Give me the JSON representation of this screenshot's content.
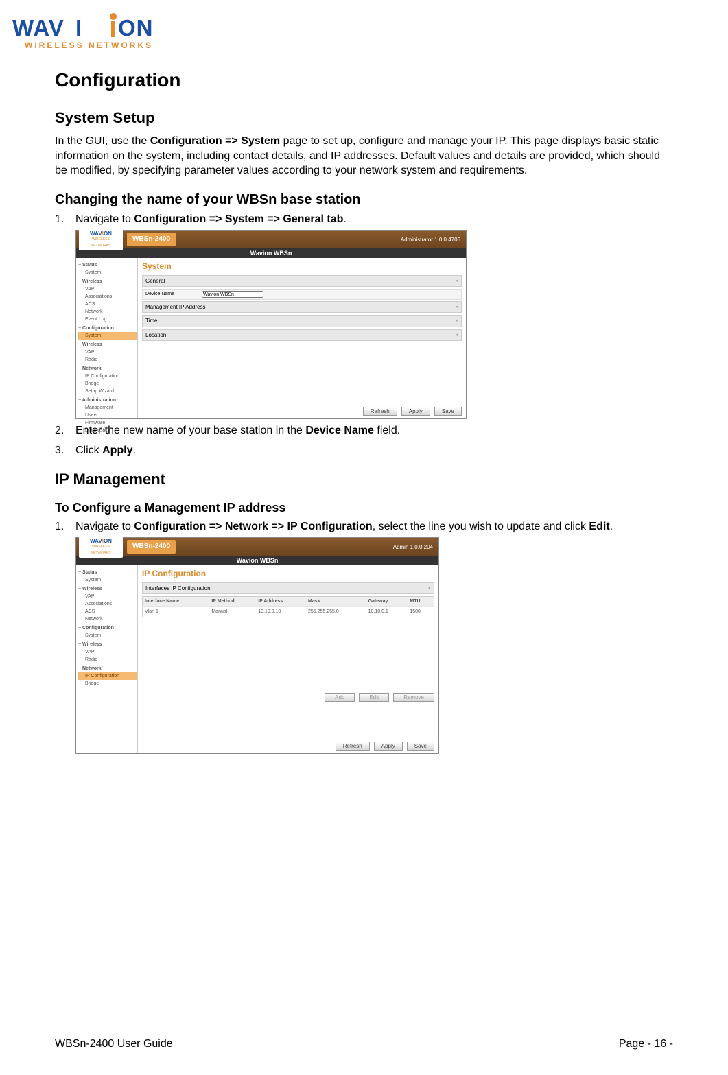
{
  "logo": {
    "brand_top": "WAV",
    "brand_dot_letter": "I",
    "brand_end": "ON",
    "tagline": "WIRELESS NETWORKS"
  },
  "headings": {
    "h1": "Configuration",
    "h2_system_setup": "System Setup",
    "h3_changing_name": "Changing the name of your WBSn base station",
    "h2_ip_mgmt": "IP Management",
    "h3_config_mgmt_ip": "To Configure a Management IP address"
  },
  "paragraphs": {
    "system_setup_intro_pre": "In the GUI, use the ",
    "system_setup_intro_bold": "Configuration => System",
    "system_setup_intro_post": " page to set up, configure and manage your IP. This page displays basic static information on the system, including contact details, and IP addresses. Default values and details are provided, which should be modified, by specifying parameter values according to your network system and requirements."
  },
  "steps_section1": {
    "s1_pre": "Navigate to ",
    "s1_bold": "Configuration => System => General tab",
    "s1_post": ".",
    "s2_pre": "Enter the new name of your base station in the ",
    "s2_bold": "Device Name",
    "s2_post": " field.",
    "s3_pre": "Click ",
    "s3_bold": "Apply",
    "s3_post": "."
  },
  "steps_section2": {
    "s1_pre": "Navigate to ",
    "s1_bold1": "Configuration => Network => IP Configuration",
    "s1_mid": ", select the line you wish to update and click ",
    "s1_bold2": "Edit",
    "s1_post": "."
  },
  "screenshot1": {
    "product": "WBSn-2400",
    "admin": "Administrator 1.0.0.4706",
    "subheader": "Wavion WBSn",
    "nav": {
      "g1": "Status",
      "i1a": "System",
      "g2": "Wireless",
      "i2a": "VAP",
      "i2b": "Associations",
      "i2c": "ACS",
      "i3": "Network",
      "i4": "Event Log",
      "g3": "Configuration",
      "sel": "System",
      "g4": "Wireless",
      "i5": "VAP",
      "i6": "Radio",
      "g5": "Network",
      "i7": "IP Configuration",
      "i8": "Bridge",
      "i9": "Setup Wizard",
      "g6": "Administration",
      "i10": "Management",
      "i11": "Users",
      "i12": "Firmware",
      "i13": "Diagnostics"
    },
    "page_title": "System",
    "sec_general": "General",
    "row_device_name_label": "Device Name",
    "row_device_name_value": "Wavion WBSn",
    "sec_mgmt_ip": "Management IP Address",
    "sec_time": "Time",
    "sec_location": "Location",
    "btn_refresh": "Refresh",
    "btn_apply": "Apply",
    "btn_save": "Save"
  },
  "screenshot2": {
    "product": "WBSn-2400",
    "admin": "Admin 1.0.0.204",
    "subheader": "Wavion WBSn",
    "nav": {
      "g1": "Status",
      "i1": "System",
      "g2": "Wireless",
      "i2": "VAP",
      "i3": "Associations",
      "i4": "ACS",
      "i5": "Network",
      "g3": "Configuration",
      "i6": "System",
      "g4": "Wireless",
      "i7": "VAP",
      "i8": "Radio",
      "g5": "Network",
      "sel": "IP Configuration",
      "i9": "Bridge"
    },
    "page_title": "IP Configuration",
    "sec_interfaces": "Interfaces IP Configuration",
    "th_iface": "Interface Name",
    "th_method": "IP Method",
    "th_addr": "IP Address",
    "th_mask": "Mask",
    "th_gw": "Gateway",
    "th_mtu": "MTU",
    "td_iface": "Vlan 1",
    "td_method": "Manual",
    "td_addr": "10.10.0.10",
    "td_mask": "255.255.255.0",
    "td_gw": "10.10.0.1",
    "td_mtu": "1500",
    "btn_add": "Add",
    "btn_edit": "Edit",
    "btn_remove": "Remove",
    "btn_refresh": "Refresh",
    "btn_apply": "Apply",
    "btn_save": "Save"
  },
  "footer": {
    "left": "WBSn-2400 User Guide",
    "right": "Page - 16 -"
  }
}
